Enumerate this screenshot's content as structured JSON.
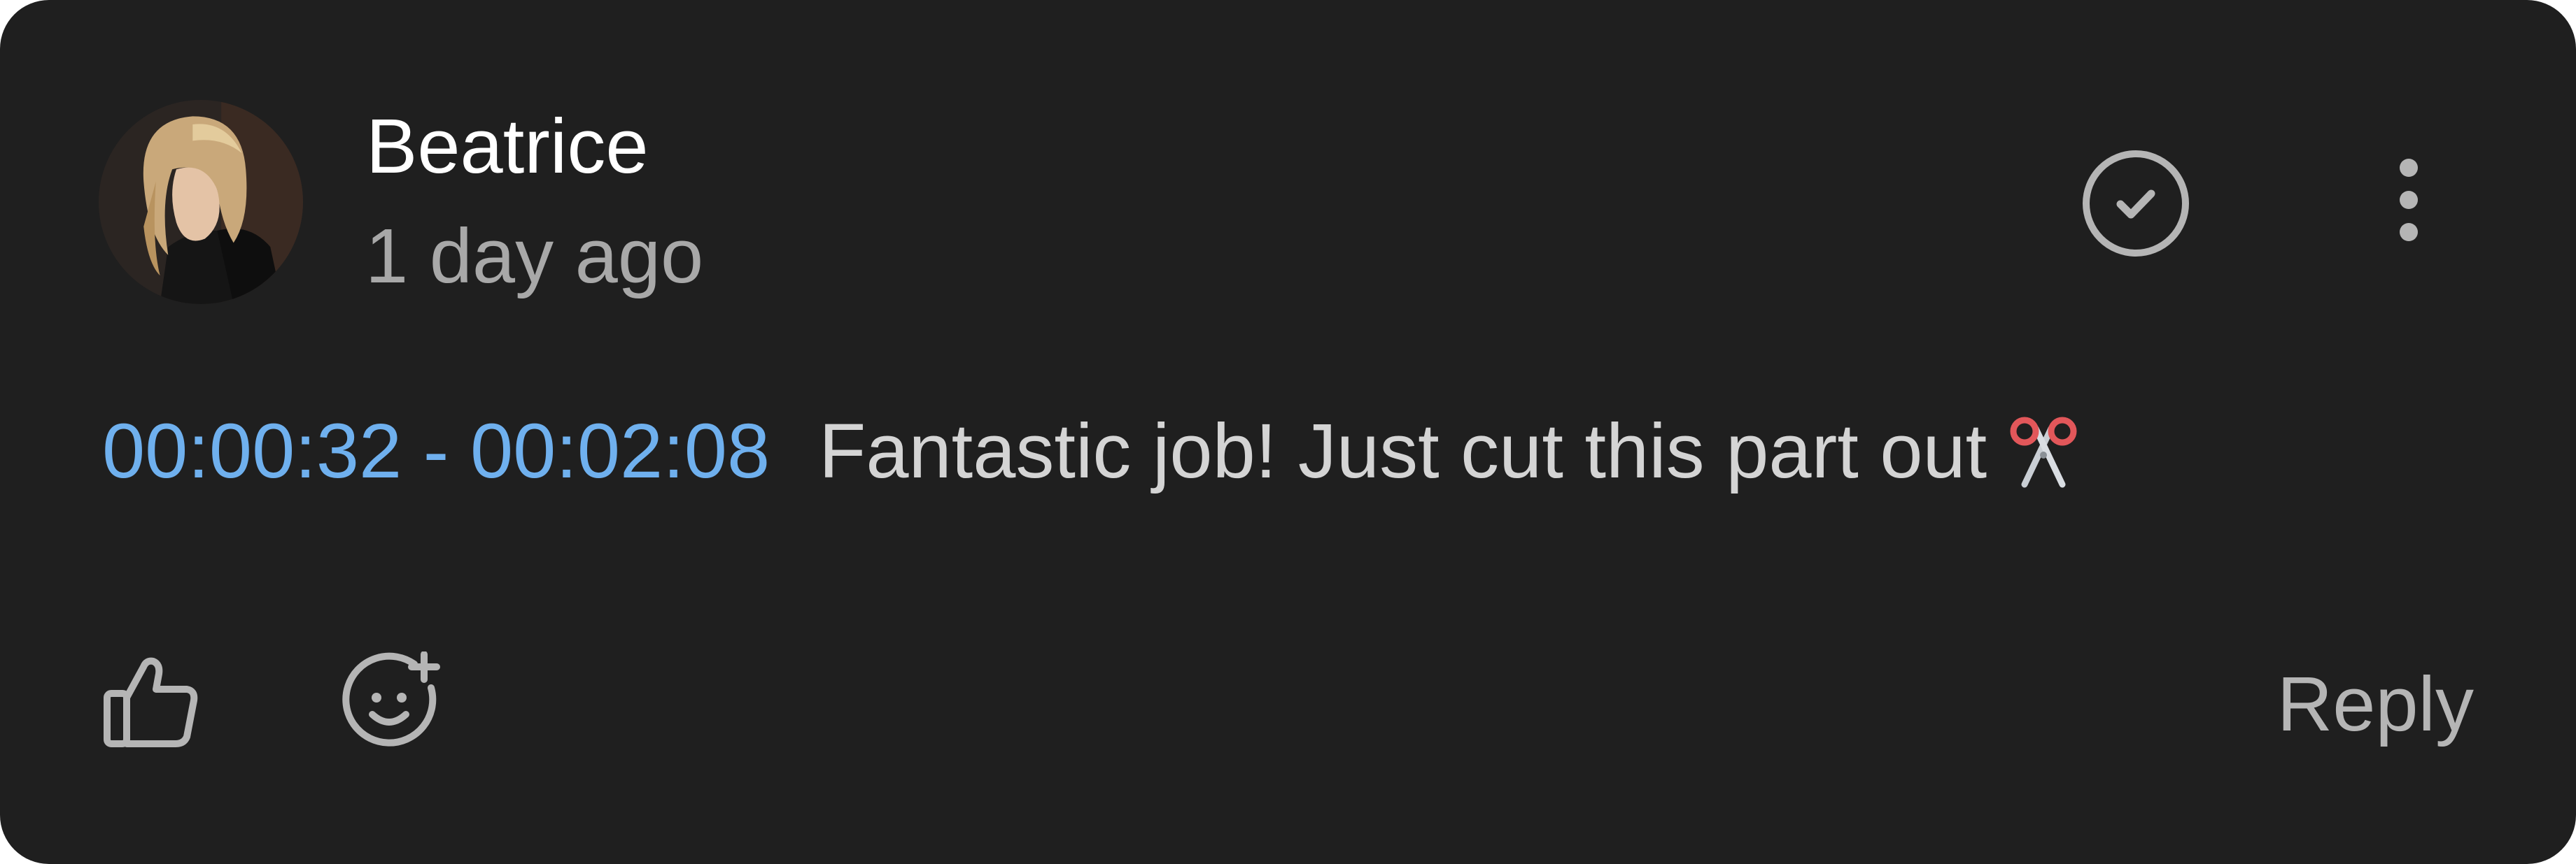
{
  "comment": {
    "author": "Beatrice",
    "time_ago": "1 day ago",
    "timecode": "00:00:32 - 00:02:08",
    "text": "Fantastic job! Just cut this part out",
    "emoji": "scissors-icon"
  },
  "actions": {
    "resolve_icon": "check-circle-icon",
    "more_icon": "vertical-ellipsis-icon",
    "like_icon": "thumbs-up-icon",
    "react_icon": "add-reaction-icon",
    "reply_label": "Reply"
  },
  "colors": {
    "card_background": "#1f1f1f",
    "timecode": "#6fb0ee",
    "primary_text": "#ffffff",
    "secondary_text": "#a8a8a8",
    "icon": "#b5b5b5"
  }
}
